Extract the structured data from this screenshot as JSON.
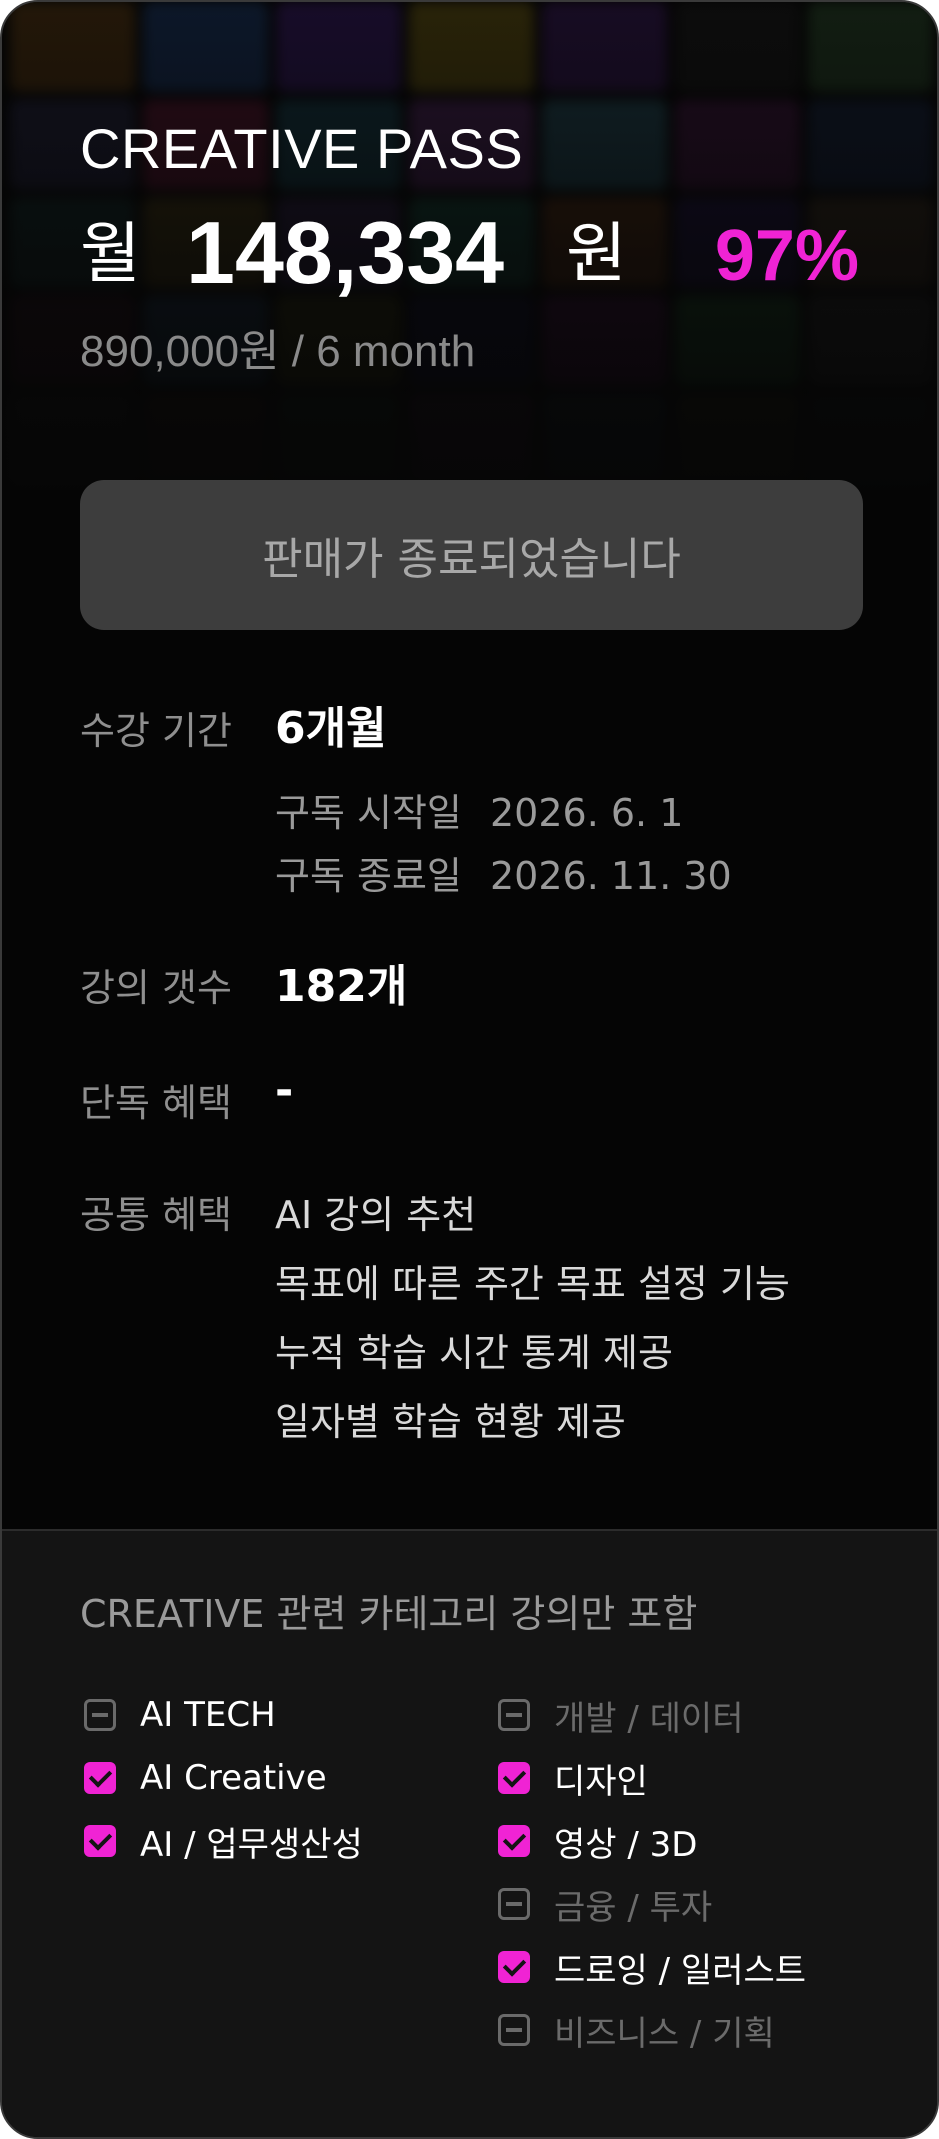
{
  "plan": {
    "title": "CREATIVE PASS",
    "price_prefix": "월",
    "price_amount": "148,334",
    "price_unit": "원",
    "discount": "97%",
    "original_price": "890,000원 / 6 month",
    "button_label": "판매가 종료되었습니다"
  },
  "info": {
    "period_label": "수강 기간",
    "period_value": "6개월",
    "start_label": "구독 시작일",
    "start_value": "2026. 6. 1",
    "end_label": "구독 종료일",
    "end_value": "2026. 11. 30",
    "lectures_label": "강의 갯수",
    "lectures_value": "182개",
    "exclusive_label": "단독 혜택",
    "exclusive_value": "-",
    "common_label": "공통 혜택",
    "common_benefits": [
      "AI 강의 추천",
      "목표에 따른 주간 목표 설정 기능",
      "누적 학습 시간 통계 제공",
      "일자별 학습 현황 제공"
    ]
  },
  "categories": {
    "title": "CREATIVE 관련 카테고리 강의만 포함",
    "left": [
      {
        "label": "AI TECH",
        "checked": false
      },
      {
        "label": "AI Creative",
        "checked": true
      },
      {
        "label": "AI / 업무생산성",
        "checked": true
      }
    ],
    "right": [
      {
        "label": "개발 / 데이터",
        "checked": false
      },
      {
        "label": "디자인",
        "checked": true
      },
      {
        "label": "영상 / 3D",
        "checked": true
      },
      {
        "label": "금융 / 투자",
        "checked": false
      },
      {
        "label": "드로잉 / 일러스트",
        "checked": true
      },
      {
        "label": "비즈니스 / 기획",
        "checked": false
      }
    ]
  },
  "colors": {
    "accent": "#f023d4",
    "background": "#050505",
    "panel": "#141414",
    "button": "#3d3d3d"
  }
}
